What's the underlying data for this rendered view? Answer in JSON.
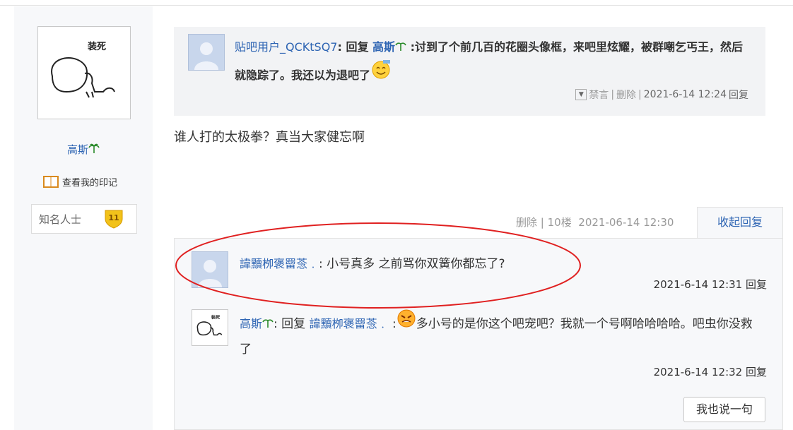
{
  "left": {
    "username": "高斯",
    "yinji_label": "查看我的印记",
    "honor_label": "知名人士",
    "level": "11"
  },
  "quote": {
    "user": "贴吧用户_QCKtSQ7",
    "reply_word": "回复",
    "target": "高斯",
    "text": ":讨到了个前几百的花圈头像框，来吧里炫耀，被群嘲乞丐王，然后就隐踪了。我还以为退吧了",
    "mute_label": "禁言",
    "delete_label": "删除",
    "time": "2021-6-14 12:24",
    "reply_label": "回复"
  },
  "post": {
    "content": "谁人打的太极拳？真当大家健忘啊"
  },
  "floor": {
    "delete_label": "删除",
    "floor_no": "10楼",
    "time": "2021-06-14 12:30",
    "collapse_label": "收起回复"
  },
  "replies": [
    {
      "user": "諱黷栁褒罶菍﹒",
      "text": "小号真多 之前骂你双簧你都忘了?",
      "time": "2021-6-14 12:31",
      "reply_label": "回复"
    },
    {
      "user": "高斯",
      "reply_word": "回复",
      "target": "諱黷栁褒罶菍﹒",
      "text": "多小号的是你这个吧宠吧？我就一个号啊哈哈哈哈。吧虫你没救了",
      "time": "2021-6-14 12:32",
      "reply_label": "回复"
    }
  ],
  "say_button": "我也说一句",
  "colors": {
    "link": "#2d64b3",
    "annotation": "#e02020"
  }
}
